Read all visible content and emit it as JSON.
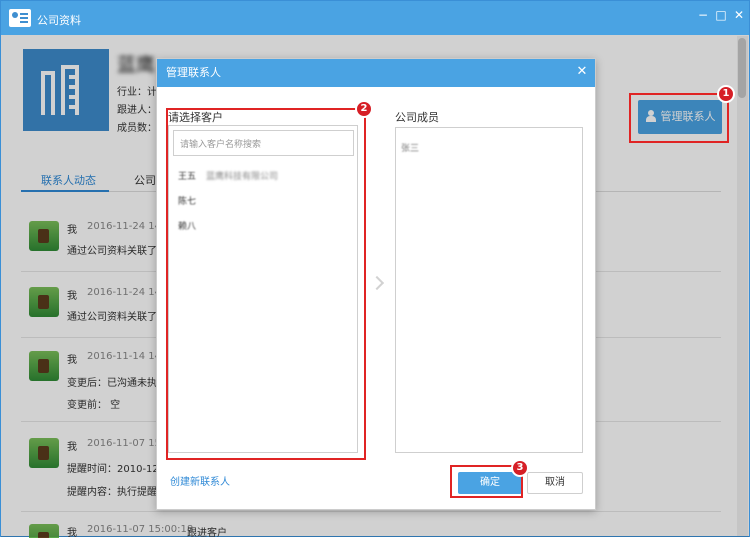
{
  "window": {
    "title": "公司资料",
    "controls": {
      "minimize": "−",
      "maximize": "□",
      "close": "✕"
    }
  },
  "company": {
    "name": "蓝鹰",
    "industry_label": "行业：计",
    "follower_label": "跟进人：",
    "members_label": "成员数："
  },
  "header": {
    "manage_btn_label": "管理联系人"
  },
  "tabs": {
    "items": [
      "联系人动态",
      "公司"
    ]
  },
  "activities": [
    {
      "user": "我",
      "time": "2016-11-24 14:0",
      "line1": "通过公司资料关联了客",
      "line2": ""
    },
    {
      "user": "我",
      "time": "2016-11-24 14:0",
      "line1": "通过公司资料关联了客",
      "line2": ""
    },
    {
      "user": "我",
      "time": "2016-11-14 14:5",
      "line1": "变更后：已沟通未执行",
      "line2": "变更前： 空"
    },
    {
      "user": "我",
      "time": "2016-11-07 15:0",
      "line1": "提醒时间：2010-12-0",
      "line2": "提醒内容：执行提醒例"
    },
    {
      "user": "我",
      "time": "2016-11-07 15:00:18",
      "line1": "跟进客户",
      "line2": ""
    }
  ],
  "dialog": {
    "title": "管理联系人",
    "close_icon": "✕",
    "left_label": "请选择客户",
    "search_placeholder": "请输入客户名称搜索",
    "left_items": [
      {
        "name": "王五",
        "company": "蓝鹰科技有限公司"
      },
      {
        "name": "陈七",
        "company": ""
      },
      {
        "name": "赖八",
        "company": ""
      }
    ],
    "right_label": "公司成员",
    "right_items": [
      "张三"
    ],
    "create_link": "创建新联系人",
    "confirm_label": "确定",
    "cancel_label": "取消"
  },
  "callouts": {
    "badge1": "1",
    "badge2": "2",
    "badge3": "3"
  },
  "colors": {
    "accent": "#4aa3e3",
    "highlight": "#e02424"
  }
}
